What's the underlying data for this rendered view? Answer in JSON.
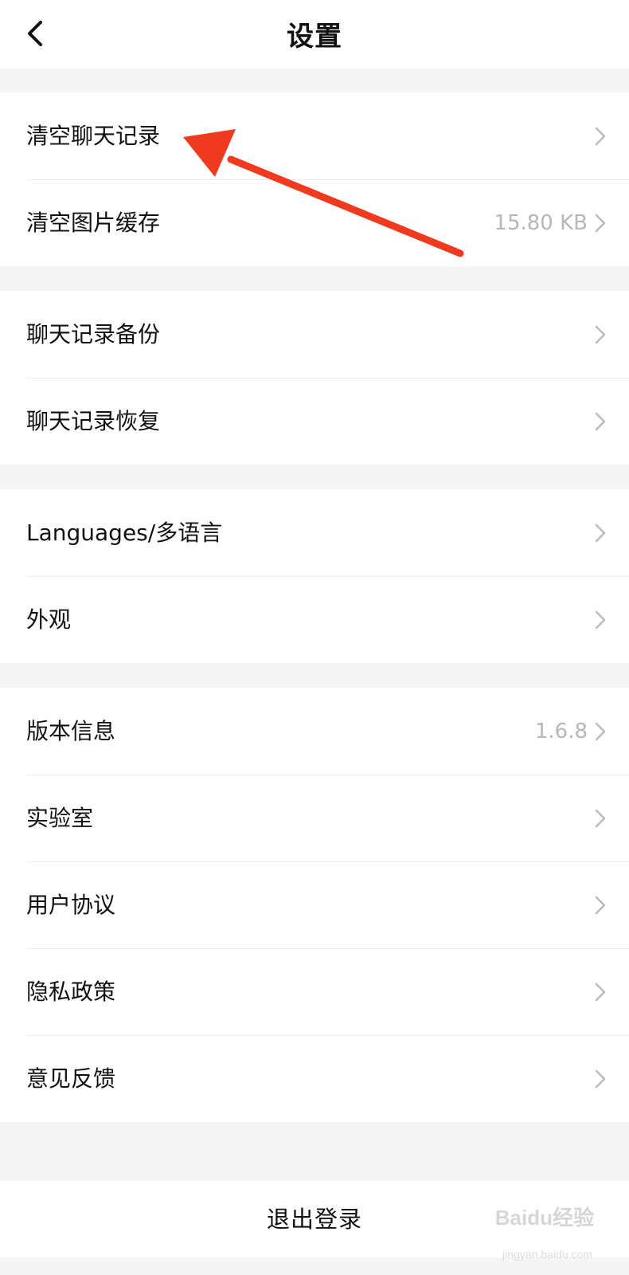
{
  "header": {
    "title": "设置"
  },
  "groups": [
    {
      "items": [
        {
          "label": "清空聊天记录",
          "value": ""
        },
        {
          "label": "清空图片缓存",
          "value": "15.80 KB"
        }
      ]
    },
    {
      "items": [
        {
          "label": "聊天记录备份",
          "value": ""
        },
        {
          "label": "聊天记录恢复",
          "value": ""
        }
      ]
    },
    {
      "items": [
        {
          "label": "Languages/多语言",
          "value": ""
        },
        {
          "label": "外观",
          "value": ""
        }
      ]
    },
    {
      "items": [
        {
          "label": "版本信息",
          "value": "1.6.8"
        },
        {
          "label": "实验室",
          "value": ""
        },
        {
          "label": "用户协议",
          "value": ""
        },
        {
          "label": "隐私政策",
          "value": ""
        },
        {
          "label": "意见反馈",
          "value": ""
        }
      ]
    }
  ],
  "logout_label": "退出登录",
  "watermark": {
    "brand": "Baidu经验",
    "url": "jingyan.baidu.com"
  },
  "colors": {
    "annotation_arrow": "#f03a1f",
    "value_text": "#b7b7b7"
  },
  "icons": {
    "back": "chevron-left-icon",
    "row": "chevron-right-icon"
  }
}
